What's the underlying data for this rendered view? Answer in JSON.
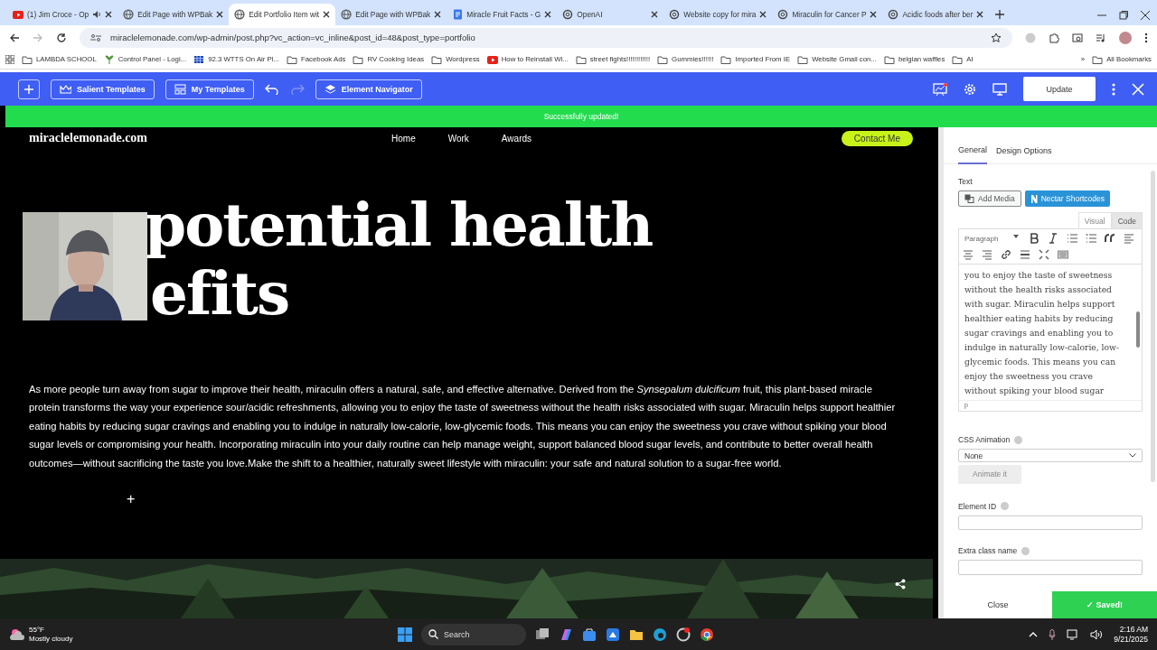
{
  "browser": {
    "tabs": [
      {
        "title": "(1) Jim Croce - Op",
        "kind": "youtube",
        "audio": true,
        "selected": false
      },
      {
        "title": "Edit Page with WPBak",
        "kind": "globe",
        "audio": false,
        "selected": false
      },
      {
        "title": "Edit Portfolio Item wit",
        "kind": "globe",
        "audio": false,
        "selected": true
      },
      {
        "title": "Edit Page with WPBak",
        "kind": "globe",
        "audio": false,
        "selected": false
      },
      {
        "title": "Miracle Fruit Facts - G",
        "kind": "docs",
        "audio": false,
        "selected": false
      },
      {
        "title": "OpenAI",
        "kind": "openai",
        "audio": false,
        "selected": false
      },
      {
        "title": "Website copy for mira",
        "kind": "openai",
        "audio": false,
        "selected": false
      },
      {
        "title": "Miraculin for Cancer P",
        "kind": "openai",
        "audio": false,
        "selected": false
      },
      {
        "title": "Acidic foods after ber",
        "kind": "openai",
        "audio": false,
        "selected": false
      }
    ],
    "address": "miraclelemonade.com/wp-admin/post.php?vc_action=vc_inline&post_id=48&post_type=portfolio",
    "bookmarks": [
      {
        "label": "LAMBDA SCHOOL",
        "kind": "folder"
      },
      {
        "label": "Control Panel - Logi...",
        "kind": "plant"
      },
      {
        "label": "92.3 WTTS On Air Pl...",
        "kind": "grid"
      },
      {
        "label": "Facebook Ads",
        "kind": "folder"
      },
      {
        "label": "RV Cooking Ideas",
        "kind": "folder"
      },
      {
        "label": "Wordpress",
        "kind": "folder"
      },
      {
        "label": "How to Reinstall Wi...",
        "kind": "youtube"
      },
      {
        "label": "street fights!!!!!!!!!!!!",
        "kind": "folder"
      },
      {
        "label": "Gummies!!!!!!",
        "kind": "folder"
      },
      {
        "label": "Imported From IE",
        "kind": "folder"
      },
      {
        "label": "Website Gmail con...",
        "kind": "folder"
      },
      {
        "label": "belgian waffles",
        "kind": "folder"
      },
      {
        "label": "AI",
        "kind": "folder"
      }
    ],
    "bookmarks_overflow": "»",
    "all_bookmarks": "All Bookmarks"
  },
  "builder_toolbar": {
    "buttons": [
      {
        "label": "Salient Templates",
        "kind": "crown"
      },
      {
        "label": "My Templates",
        "kind": "templates"
      },
      {
        "label": "Element Navigator",
        "kind": "layers"
      }
    ],
    "update": "Update"
  },
  "notice": "Successfully updated!",
  "site": {
    "logo": "miraclelemonade.com",
    "nav": [
      "Home",
      "Work",
      "Awards"
    ],
    "cta": "Contact Me",
    "heading": [
      "potential health",
      "efits"
    ],
    "body": "As more people turn away from sugar to improve their health, miraculin offers a natural, safe, and effective alternative. Derived from the *Synsepalum dulcificum* fruit, this plant-based miracle protein transforms the way your experience sour/acidic refreshments, allowing you to enjoy the taste of sweetness without the health risks associated with sugar. Miraculin helps support healthier eating habits by reducing sugar cravings and enabling you to indulge in naturally low-calorie, low-glycemic foods. This means you can enjoy the sweetness you crave without spiking your blood sugar levels or compromising your health. Incorporating miraculin into your daily routine can help manage weight, support balanced blood sugar levels, and contribute to better overall health outcomes—without sacrificing the taste you love.Make the shift to a healthier, naturally sweet lifestyle with miraculin: your safe and natural solution to a sugar-free world.",
    "add": "+"
  },
  "panel": {
    "tabs": [
      {
        "label": "General",
        "selected": true
      },
      {
        "label": "Design Options",
        "selected": false
      }
    ],
    "text_label": "Text",
    "add_media": "Add Media",
    "nectar": "Nectar Shortcodes",
    "modes": [
      {
        "label": "Visual",
        "selected": true
      },
      {
        "label": "Code",
        "selected": false
      }
    ],
    "format": "Paragraph",
    "editor_lines": [
      "you to enjoy the taste of sweetness",
      "without the health risks associated",
      "with sugar. Miraculin helps support",
      "healthier eating habits by reducing",
      "sugar cravings and enabling you to",
      "indulge in naturally low-calorie, low-",
      "glycemic foods. This means you can",
      "enjoy the sweetness you crave",
      "without spiking your blood sugar"
    ],
    "path": "p",
    "css_animation_label": "CSS Animation",
    "css_animation": "None",
    "animate": "Animate it",
    "element_id_label": "Element ID",
    "extra_class_label": "Extra class name",
    "close": "Close",
    "saved": "✓ Saved!"
  },
  "taskbar": {
    "temp": "55°F",
    "weather": "Mostly cloudy",
    "search": "Search",
    "time": "2:16 AM",
    "date": "9/21/2025"
  }
}
